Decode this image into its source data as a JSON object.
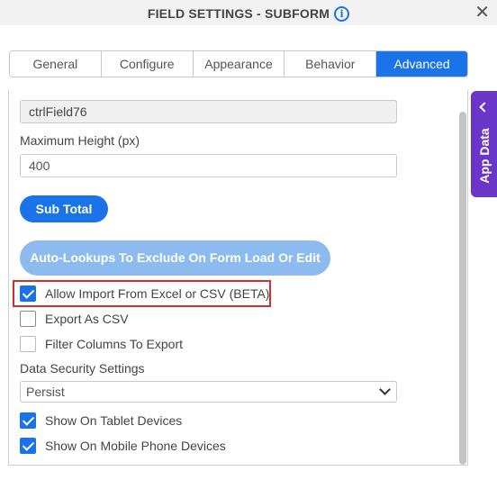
{
  "header": {
    "title": "FIELD SETTINGS - SUBFORM",
    "info_icon": "i",
    "close_icon": "✕"
  },
  "tabs": [
    {
      "label": "General",
      "active": false
    },
    {
      "label": "Configure",
      "active": false
    },
    {
      "label": "Appearance",
      "active": false
    },
    {
      "label": "Behavior",
      "active": false
    },
    {
      "label": "Advanced",
      "active": true
    }
  ],
  "form": {
    "control_name_value": "ctrlField76",
    "max_height_label": "Maximum Height (px)",
    "max_height_value": "400",
    "sub_total_button": "Sub Total",
    "auto_lookups_button": "Auto-Lookups To Exclude On Form Load Or Edit",
    "allow_import_label": "Allow Import From Excel or CSV (BETA)",
    "allow_import_checked": true,
    "export_csv_label": "Export As CSV",
    "export_csv_checked": false,
    "filter_columns_label": "Filter Columns To Export",
    "filter_columns_checked": false,
    "data_security_label": "Data Security Settings",
    "data_security_value": "Persist",
    "show_tablet_label": "Show On Tablet Devices",
    "show_tablet_checked": true,
    "show_mobile_label": "Show On Mobile Phone Devices",
    "show_mobile_checked": true
  },
  "side_panel": {
    "label": "App Data"
  },
  "colors": {
    "accent": "#1a73e8",
    "accent_disabled": "#8dbbf0",
    "side_panel": "#6a35c9",
    "highlight": "#d32f2f"
  }
}
